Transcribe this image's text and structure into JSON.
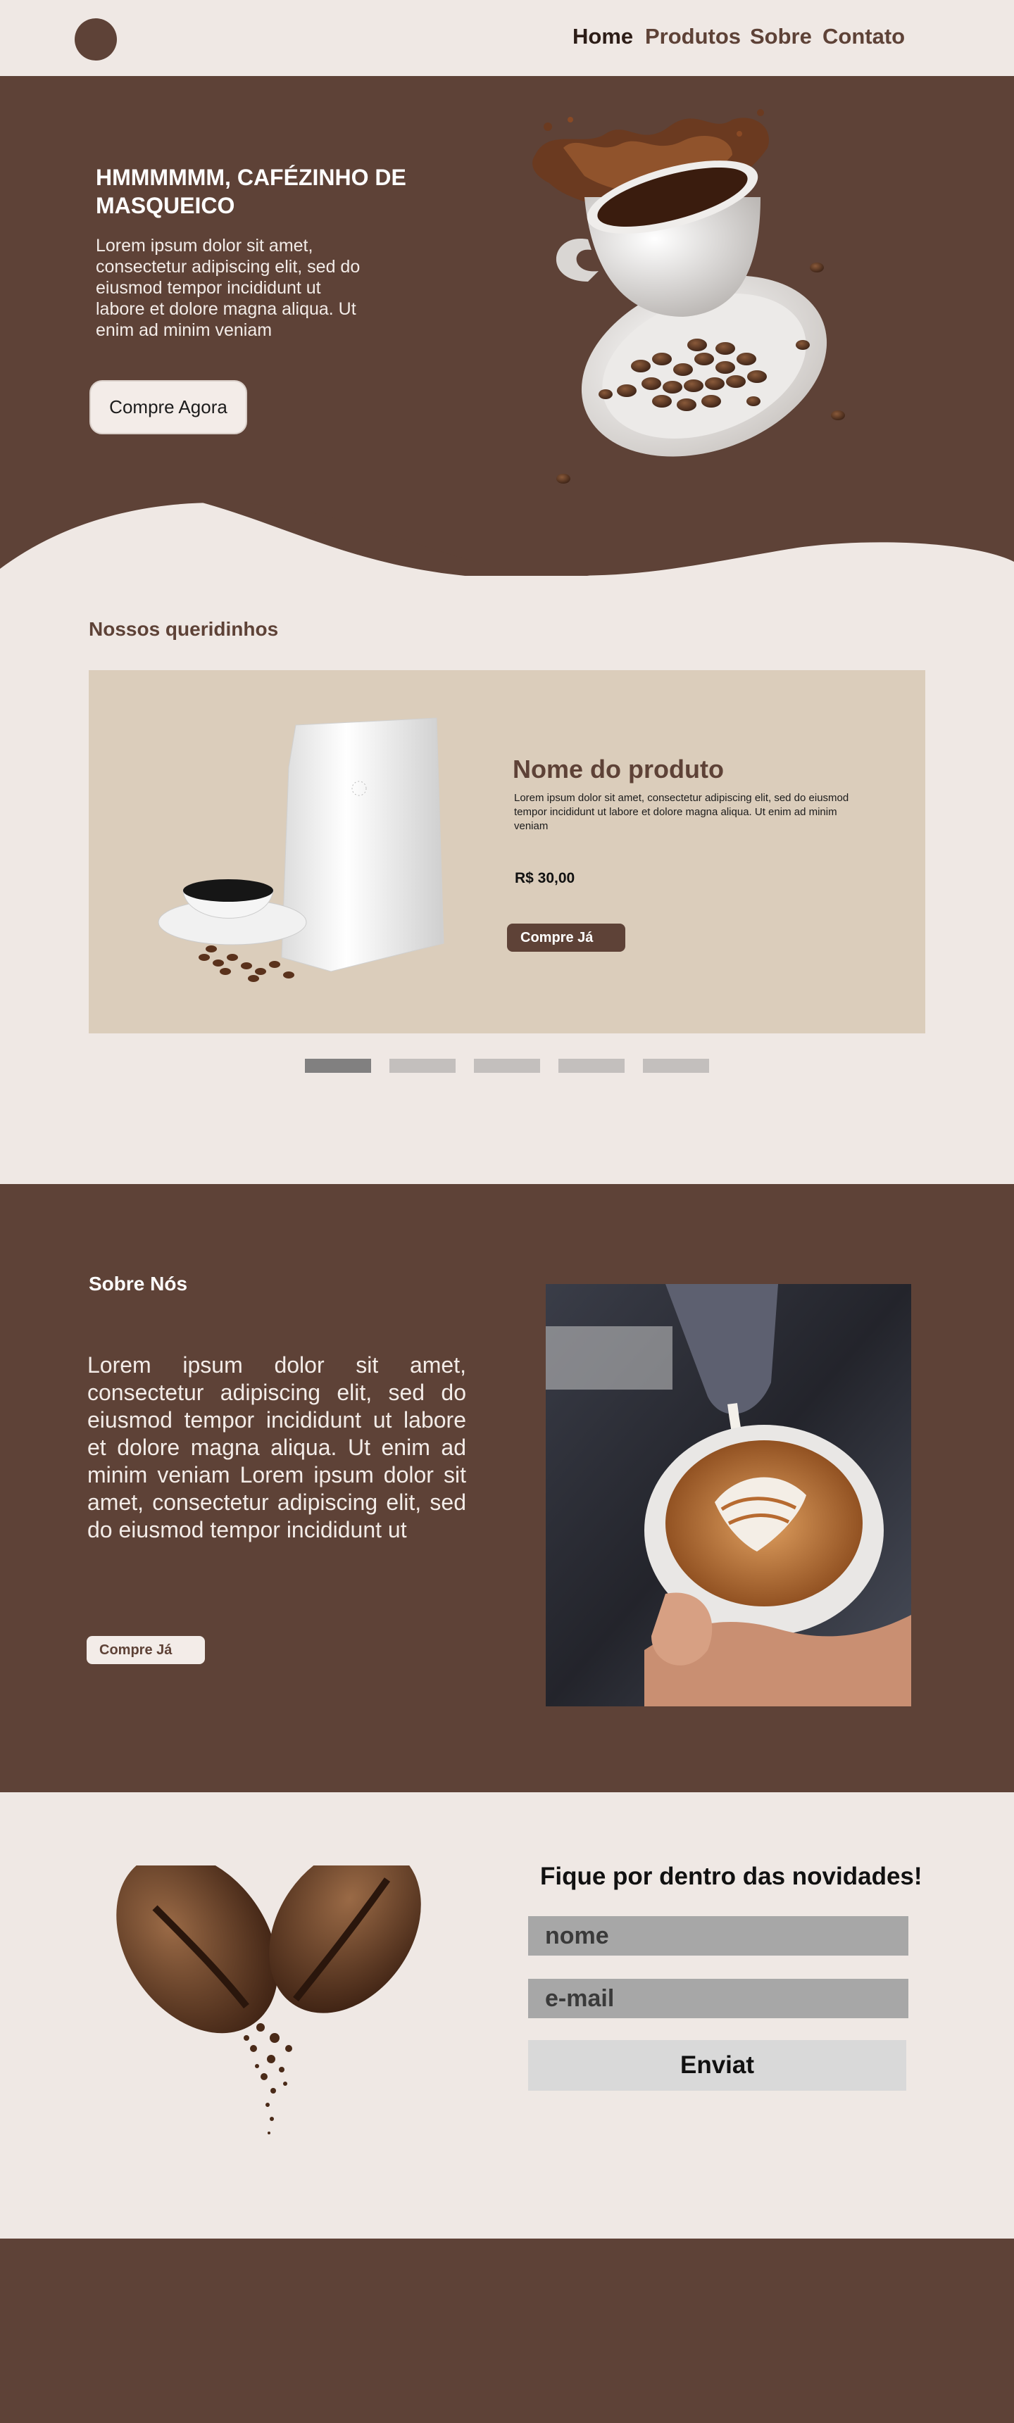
{
  "header": {
    "nav": {
      "home": "Home",
      "produtos": "Produtos",
      "sobre": "Sobre",
      "contato": "Contato"
    }
  },
  "hero": {
    "title": "HMMMMMM, CAFÉZINHO DE MASQUEICO",
    "text": "Lorem ipsum dolor sit amet, consectetur adipiscing elit, sed do eiusmod tempor incididunt ut labore et dolore magna aliqua. Ut enim ad minim veniam",
    "button_label": "Compre Agora"
  },
  "favorites": {
    "title": "Nossos queridinhos",
    "product": {
      "name": "Nome do produto",
      "description": "Lorem ipsum dolor sit amet, consectetur adipiscing elit, sed do eiusmod tempor incididunt ut labore et dolore magna aliqua. Ut enim ad minim veniam",
      "price": "R$ 30,00",
      "button_label": "Compre Já"
    },
    "carousel_slides": 5,
    "active_slide": 1
  },
  "about": {
    "title": "Sobre Nós",
    "text": "Lorem ipsum dolor sit amet, consectetur adipiscing elit, sed do eiusmod tempor incididunt ut labore et dolore magna aliqua. Ut enim ad minim veniam Lorem ipsum dolor sit amet, consectetur adipiscing elit, sed do eiusmod tempor incididunt ut",
    "button_label": "Compre Já"
  },
  "newsletter": {
    "title": "Fique por dentro das novidades!",
    "name_placeholder": "nome",
    "email_placeholder": "e-mail",
    "button_label": "Enviat"
  },
  "colors": {
    "brown": "#5e4237",
    "cream": "#efe8e4",
    "beige": "#dbcdbb"
  }
}
